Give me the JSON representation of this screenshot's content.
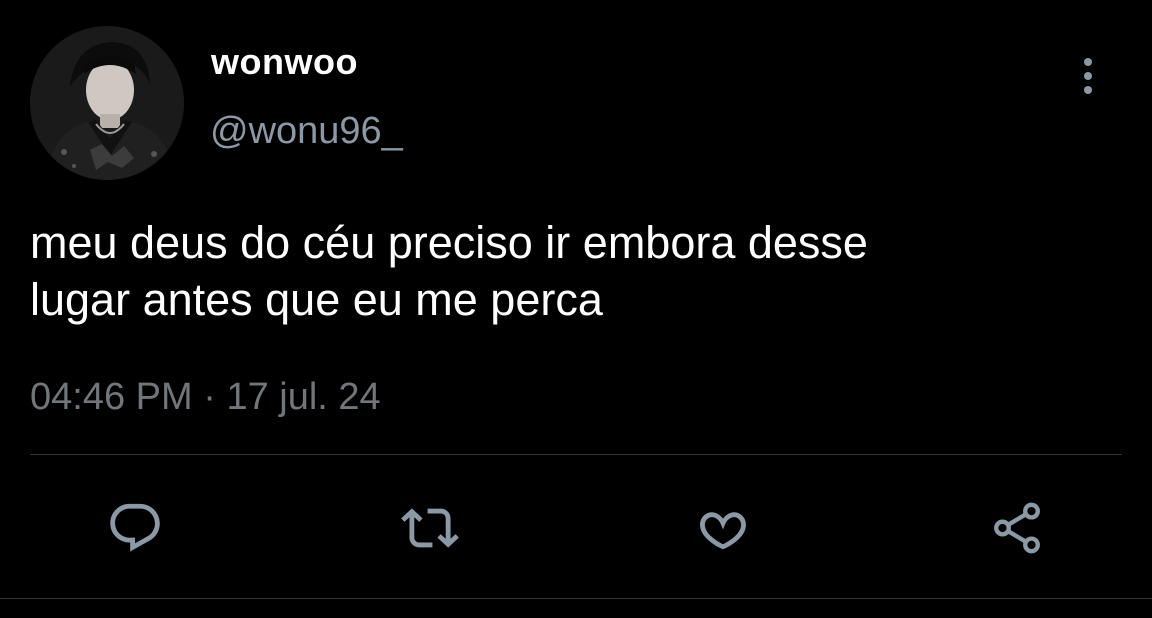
{
  "user": {
    "display_name": "wonwoo",
    "handle": "@wonu96_"
  },
  "tweet": {
    "text_lines": [
      "meu deus do céu preciso ir embora desse",
      "lugar antes que eu me perca"
    ],
    "time": "04:46 PM",
    "separator": "·",
    "date": "17 jul. 24"
  },
  "actions": [
    {
      "icon": "reply-icon"
    },
    {
      "icon": "retweet-icon"
    },
    {
      "icon": "like-icon"
    },
    {
      "icon": "share-icon"
    }
  ],
  "colors": {
    "background": "#000000",
    "text_primary": "#ffffff",
    "text_secondary": "#71767b",
    "icon": "#8b98a5",
    "divider": "#2f3336"
  }
}
